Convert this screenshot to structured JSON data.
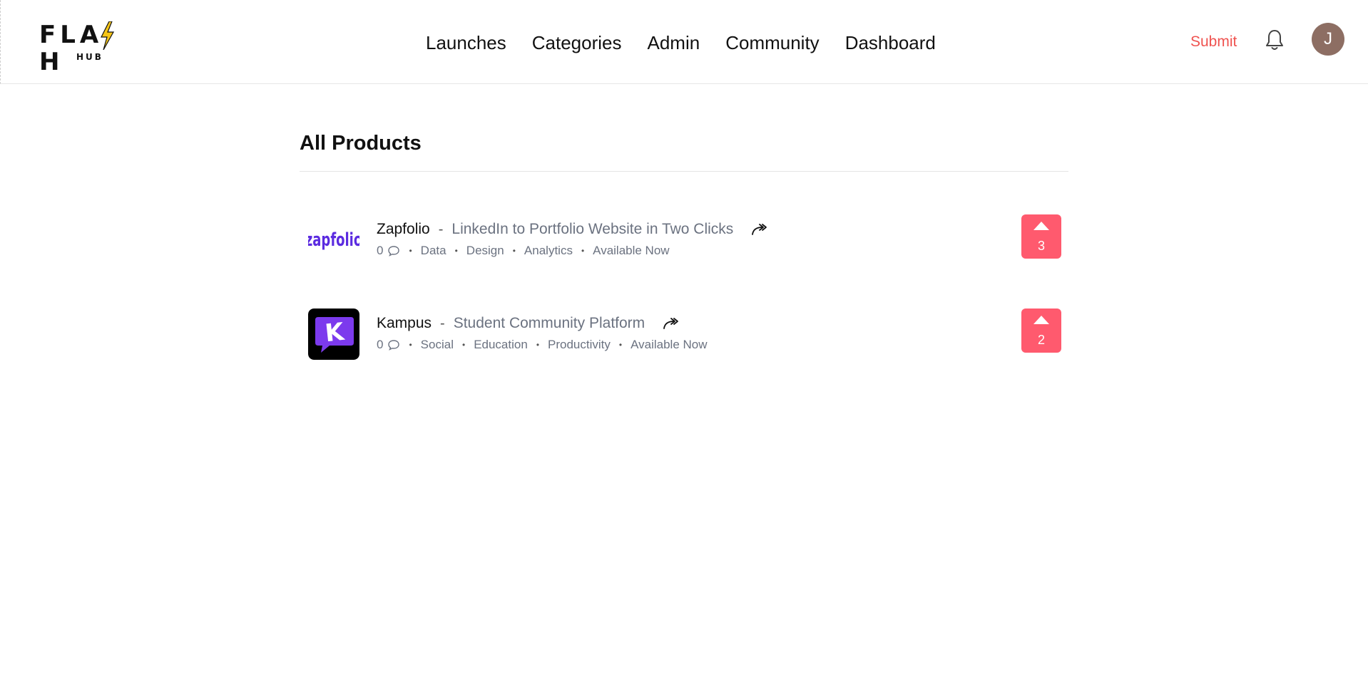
{
  "header": {
    "logo_text": "FLASH",
    "logo_sub": "HUB",
    "nav": [
      "Launches",
      "Categories",
      "Admin",
      "Community",
      "Dashboard"
    ],
    "submit_label": "Submit",
    "avatar_initial": "J",
    "colors": {
      "submit": "#ef5350",
      "avatar": "#8d6e63",
      "bolt": "#f5c518"
    }
  },
  "main": {
    "title": "All Products",
    "products": [
      {
        "name": "Zapfolio",
        "separator": "-",
        "tagline": "LinkedIn to Portfolio Website in Two Clicks",
        "comments": "0",
        "tags": [
          "Data",
          "Design",
          "Analytics",
          "Available Now"
        ],
        "votes": "3",
        "logo_text": "zapfolio",
        "logo_icon": "zapfolio-logo"
      },
      {
        "name": "Kampus",
        "separator": "-",
        "tagline": "Student Community Platform",
        "comments": "0",
        "tags": [
          "Social",
          "Education",
          "Productivity",
          "Available Now"
        ],
        "votes": "2",
        "logo_text": "K",
        "logo_icon": "kampus-logo"
      }
    ],
    "colors": {
      "vote": "#ff5a6e",
      "muted_text": "#6b7280"
    }
  }
}
